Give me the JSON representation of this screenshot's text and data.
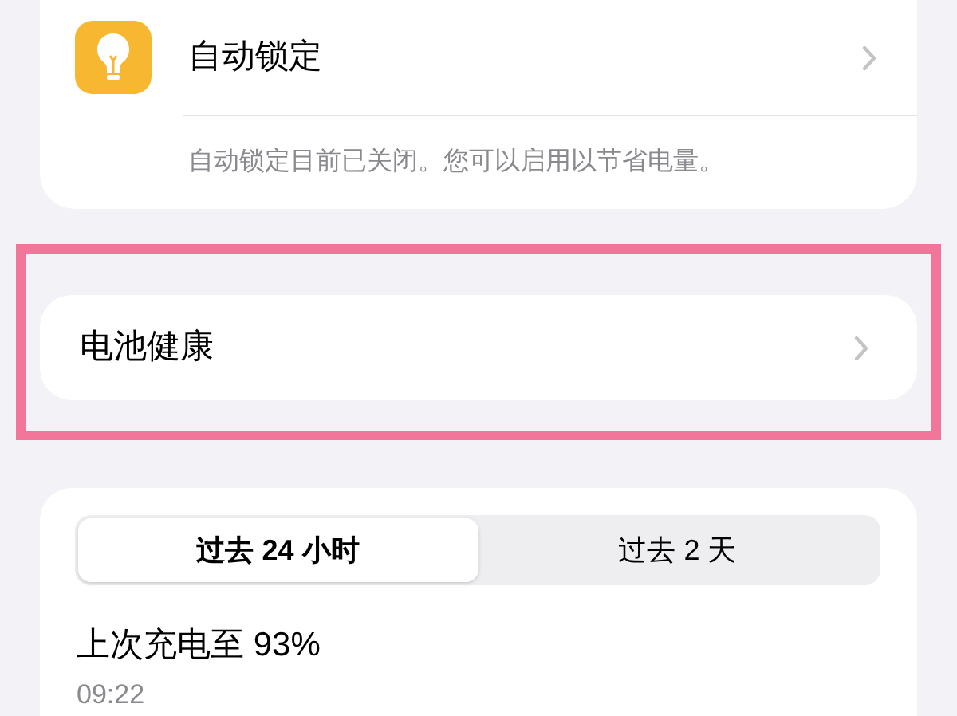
{
  "auto_lock": {
    "title": "自动锁定",
    "footnote": "自动锁定目前已关闭。您可以启用以节省电量。"
  },
  "battery_health": {
    "title": "电池健康"
  },
  "segments": [
    {
      "label": "过去 24 小时",
      "selected": true
    },
    {
      "label": "过去 2 天",
      "selected": false
    }
  ],
  "last_charge": {
    "title": "上次充电至 93%",
    "time": "09:22"
  }
}
